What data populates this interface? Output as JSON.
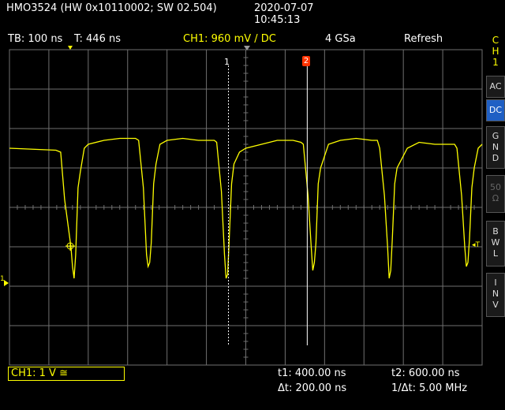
{
  "header": {
    "device": "HMO3524 (HW 0x10110002; SW 02.504)",
    "date": "2020-07-07",
    "time": "10:45:13"
  },
  "statusbar": {
    "timebase": "TB: 100 ns",
    "trigger_time": "T: 446 ns",
    "channel_setting": "CH1: 960 mV / DC",
    "sample_rate": "4 GSa",
    "mode": "Refresh"
  },
  "sidepanel": {
    "channel_letters": [
      "C",
      "H",
      "1"
    ],
    "buttons": [
      {
        "letters": [
          "AC"
        ],
        "state": "normal"
      },
      {
        "letters": [
          "DC"
        ],
        "state": "active"
      },
      {
        "letters": [
          "G",
          "N",
          "D"
        ],
        "state": "normal"
      },
      {
        "letters": [
          "50",
          "Ω"
        ],
        "state": "disabled"
      },
      {
        "letters": [
          "B",
          "W",
          "L"
        ],
        "state": "normal"
      },
      {
        "letters": [
          "I",
          "N",
          "V"
        ],
        "state": "normal"
      }
    ]
  },
  "markers": {
    "cursor1": "1",
    "cursor2": "2",
    "ground_marker": "1",
    "trigger_level_marker": "◂T"
  },
  "footer": {
    "channel_box": "CH1: 1 V ≅",
    "t1": "t1: 400.00 ns",
    "t2": "t2: 600.00 ns",
    "dt": "Δt: 200.00 ns",
    "inv_dt": "1/Δt: 5.00 MHz"
  },
  "colors": {
    "trace": "#ffff00",
    "grid": "#707070",
    "cursor": "#ffffff",
    "cursor2_marker": "#ff3300",
    "active_button": "#1f5fc4"
  },
  "chart_data": {
    "type": "line",
    "series": [
      {
        "x": [
          0,
          0.59,
          0.65,
          0.7,
          0.78,
          0.8,
          0.82,
          0.84,
          0.87,
          0.9,
          0.95,
          1.0,
          1.2,
          1.4,
          1.6,
          1.64,
          1.7,
          1.74,
          1.76,
          1.78,
          1.8,
          1.83,
          1.86,
          1.91,
          2.0,
          2.2,
          2.4,
          2.6,
          2.63,
          2.69,
          2.73,
          2.75,
          2.77,
          2.79,
          2.82,
          2.85,
          2.92,
          3.0,
          3.2,
          3.4,
          3.6,
          3.7,
          3.73,
          3.79,
          3.83,
          3.85,
          3.87,
          3.89,
          3.92,
          3.95,
          4.05,
          4.2,
          4.4,
          4.6,
          4.67,
          4.7,
          4.76,
          4.8,
          4.82,
          4.84,
          4.86,
          4.89,
          4.92,
          5.05,
          5.2,
          5.4,
          5.6,
          5.65,
          5.68,
          5.74,
          5.78,
          5.8,
          5.82,
          5.84,
          5.87,
          5.9,
          5.95,
          6.0
        ],
        "y": [
          1.5,
          1.45,
          1.4,
          0.2,
          -1.0,
          -1.5,
          -1.8,
          -1.2,
          0.5,
          0.9,
          1.5,
          1.6,
          1.7,
          1.75,
          1.75,
          1.7,
          0.5,
          -1.2,
          -1.5,
          -1.4,
          -0.9,
          0.6,
          1.1,
          1.6,
          1.7,
          1.75,
          1.7,
          1.7,
          1.65,
          0.4,
          -1.2,
          -1.8,
          -1.7,
          -0.8,
          0.6,
          1.1,
          1.4,
          1.5,
          1.6,
          1.7,
          1.7,
          1.65,
          1.6,
          0.3,
          -1.0,
          -1.6,
          -1.4,
          -0.9,
          0.6,
          1.0,
          1.6,
          1.7,
          1.75,
          1.7,
          1.7,
          1.5,
          0.3,
          -1.0,
          -1.8,
          -1.6,
          -0.8,
          0.6,
          1.0,
          1.5,
          1.65,
          1.6,
          1.6,
          1.6,
          1.5,
          0.3,
          -1.0,
          -1.5,
          -1.4,
          -0.8,
          0.5,
          1.0,
          1.5,
          1.6
        ]
      }
    ],
    "x_range": [
      0,
      6
    ],
    "y_range": [
      -4,
      4
    ],
    "grid": true,
    "cursors_x": [
      2.78,
      3.78
    ]
  }
}
